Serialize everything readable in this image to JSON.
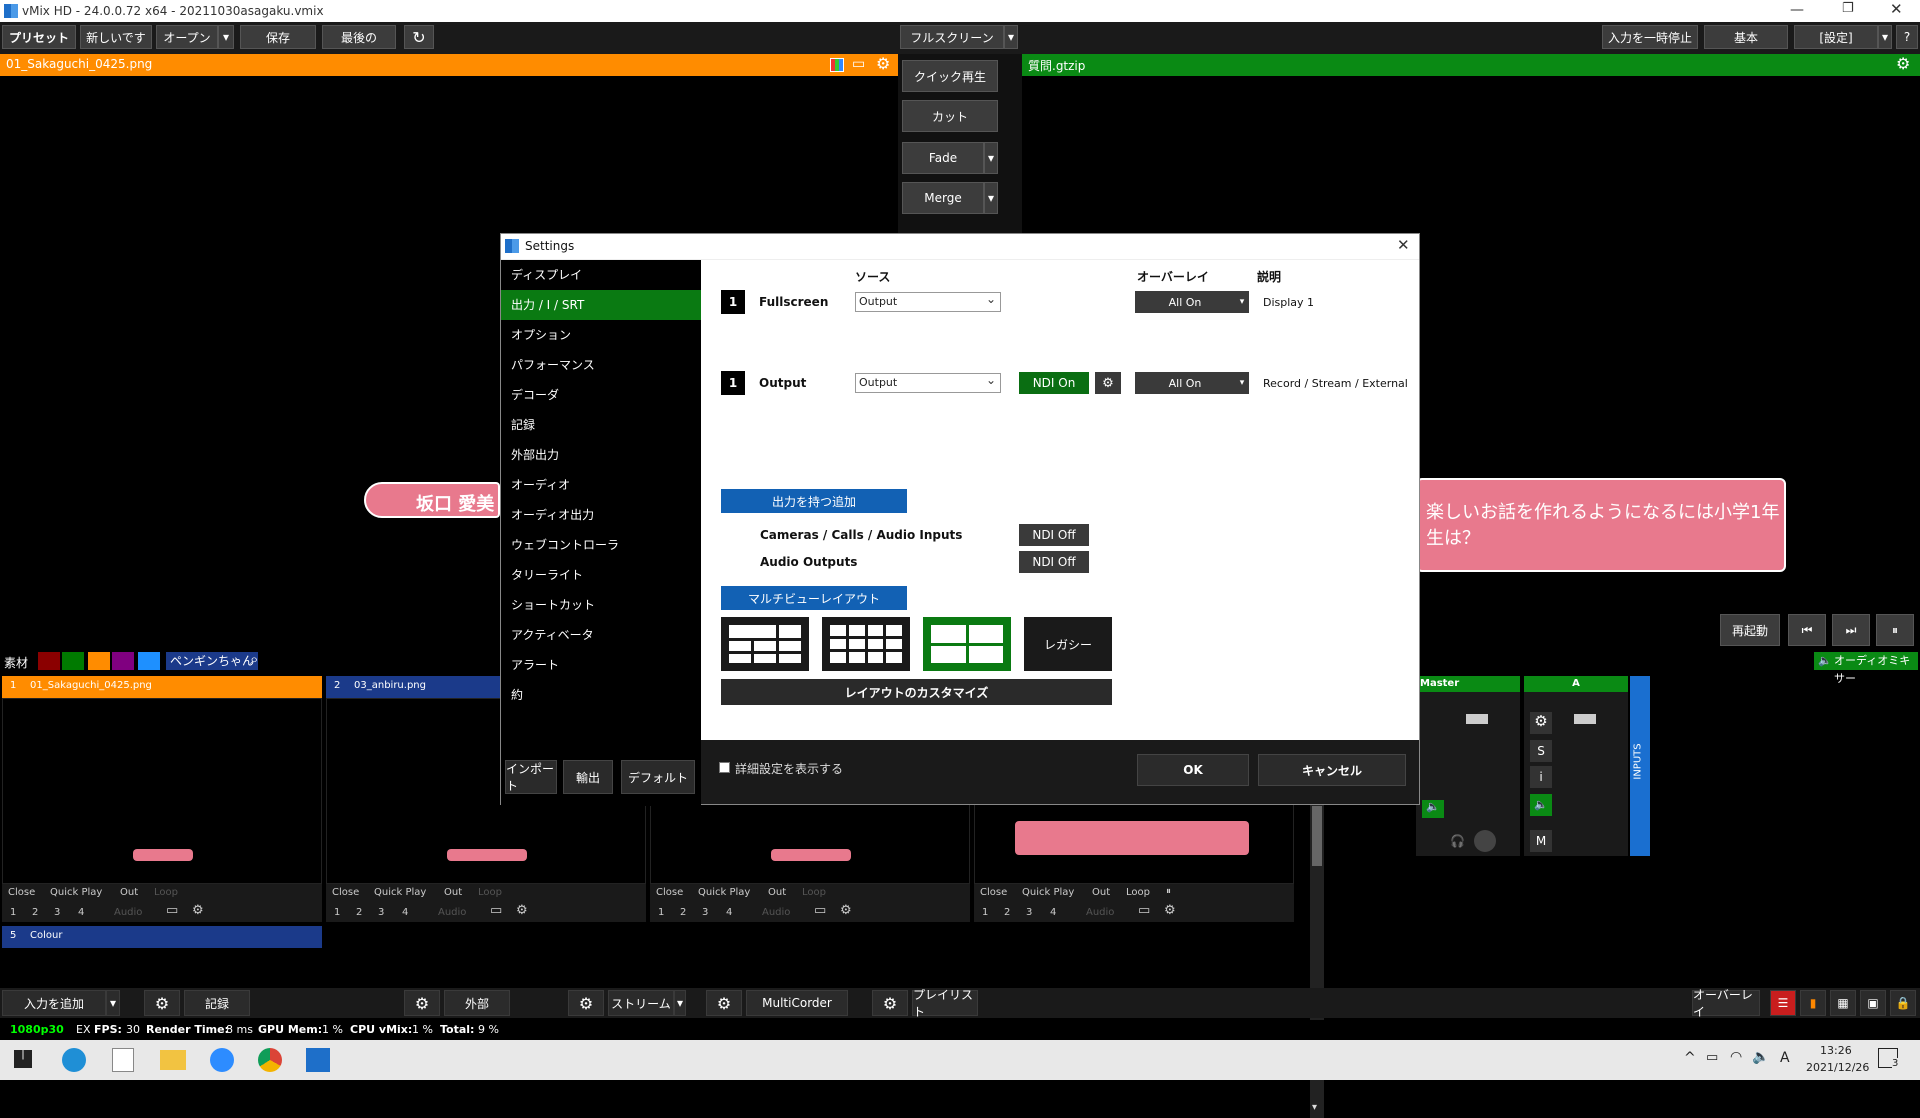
{
  "app": {
    "title": "vMix HD - 24.0.0.72 x64 - 20211030asagaku.vmix"
  },
  "toolbar": {
    "preset": "プリセット",
    "new": "新しいです",
    "open": "オープン",
    "save": "保存",
    "last": "最後の",
    "fullscreen": "フルスクリーン",
    "pause_input": "入力を一時停止",
    "basic": "基本",
    "settings": "[設定]",
    "help": "?"
  },
  "preview": {
    "title": "01_Sakaguchi_0425.png",
    "lower_third_name": "坂口 愛美"
  },
  "output": {
    "title": "質問.gtzip",
    "question_text": "楽しいお話を作れるようになるには小学1年生は？"
  },
  "transitions": {
    "quick_play": "クイック再生",
    "cut": "カット",
    "fade": "Fade",
    "merge": "Merge"
  },
  "playback": {
    "restart": "再起動"
  },
  "audio_mixer": {
    "label": "オーディオミキサー",
    "master": "Master",
    "a": "A",
    "inputs": "INPUTS"
  },
  "filters": {
    "label": "素材",
    "penguin": "ペンギンちゃん"
  },
  "inputs": [
    {
      "num": "1",
      "name": "01_Sakaguchi_0425.png"
    },
    {
      "num": "2",
      "name": "03_anbiru.png"
    },
    {
      "num": "5",
      "name": "Colour"
    }
  ],
  "input_controls": {
    "close": "Close",
    "quick_play": "Quick Play",
    "out": "Out",
    "loop": "Loop",
    "audio": "Audio",
    "n1": "1",
    "n2": "2",
    "n3": "3",
    "n4": "4"
  },
  "bottom_bar": {
    "add_input": "入力を追加",
    "record": "記録",
    "external": "外部",
    "stream": "ストリーム",
    "multicorder": "MultiCorder",
    "playlist": "プレイリスト",
    "overlay": "オーバーレイ"
  },
  "status": {
    "res": "1080p30",
    "ex": "EX",
    "fps_label": "FPS:",
    "fps": "30",
    "render_label": "Render Time:",
    "render": "8 ms",
    "gpu_label": "GPU Mem:",
    "gpu": "1 %",
    "cpu_label": "CPU vMix:",
    "cpu": "1 %",
    "total_label": "Total:",
    "total": "9 %"
  },
  "taskbar": {
    "time": "13:26",
    "date": "2021/12/26",
    "ime": "A",
    "notif": "3"
  },
  "settings_dialog": {
    "title": "Settings",
    "sidebar": [
      "ディスプレイ",
      "出力 / I / SRT",
      "オプション",
      "パフォーマンス",
      "デコーダ",
      "記録",
      "外部出力",
      "オーディオ",
      "オーディオ出力",
      "ウェブコントローラ",
      "タリーライト",
      "ショートカット",
      "アクティベータ",
      "アラート",
      "約"
    ],
    "active_index": 1,
    "headers": {
      "source": "ソース",
      "overlay": "オーバーレイ",
      "description": "説明"
    },
    "rows": [
      {
        "num": "1",
        "label": "Fullscreen",
        "source": "Output",
        "overlay": "All On",
        "description": "Display 1"
      },
      {
        "num": "1",
        "label": "Output",
        "source": "Output",
        "ndi": "NDI On",
        "overlay": "All On",
        "description": "Record / Stream / External"
      }
    ],
    "add_output": "出力を持つ追加",
    "ndi_rows": [
      {
        "label": "Cameras / Calls / Audio Inputs",
        "state": "NDI Off"
      },
      {
        "label": "Audio Outputs",
        "state": "NDI Off"
      }
    ],
    "multiview_layout": "マルチビューレイアウト",
    "legacy": "レガシー",
    "customize_layout": "レイアウトのカスタマイズ",
    "import": "インポート",
    "export": "輸出",
    "default": "デフォルト",
    "show_advanced": "詳細設定を表示する",
    "ok": "OK",
    "cancel": "キャンセル"
  }
}
